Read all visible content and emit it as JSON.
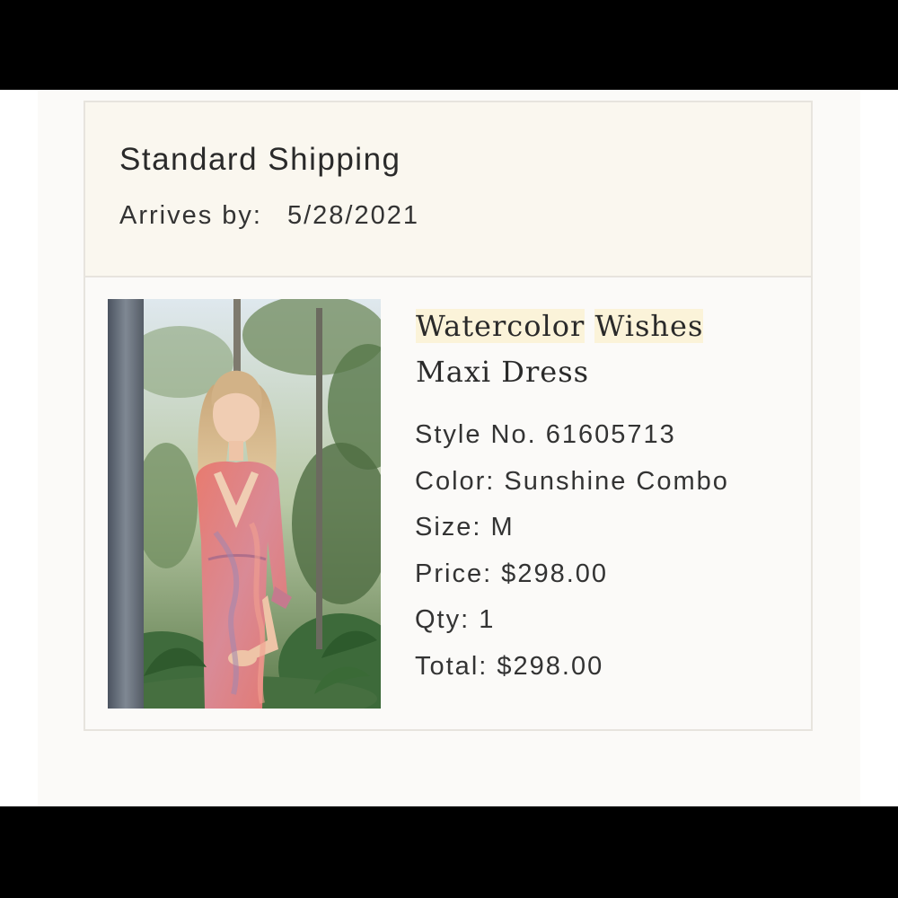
{
  "shipping": {
    "method": "Standard Shipping",
    "arrives_label": "Arrives by:",
    "arrives_date": "5/28/2021"
  },
  "product": {
    "name_word_1": "Watercolor",
    "name_word_2": "Wishes",
    "name_line_2": "Maxi Dress",
    "image_alt": "Watercolor Wishes Maxi Dress",
    "style_no": "Style No. 61605713",
    "color": "Color: Sunshine Combo",
    "size": "Size: M",
    "price": "Price: $298.00",
    "qty": "Qty: 1",
    "total": "Total: $298.00"
  },
  "colors": {
    "highlight": "#fbf3d9",
    "header_bg": "#faf7ef",
    "border": "#e7e4de",
    "text": "#2a2a2a"
  }
}
